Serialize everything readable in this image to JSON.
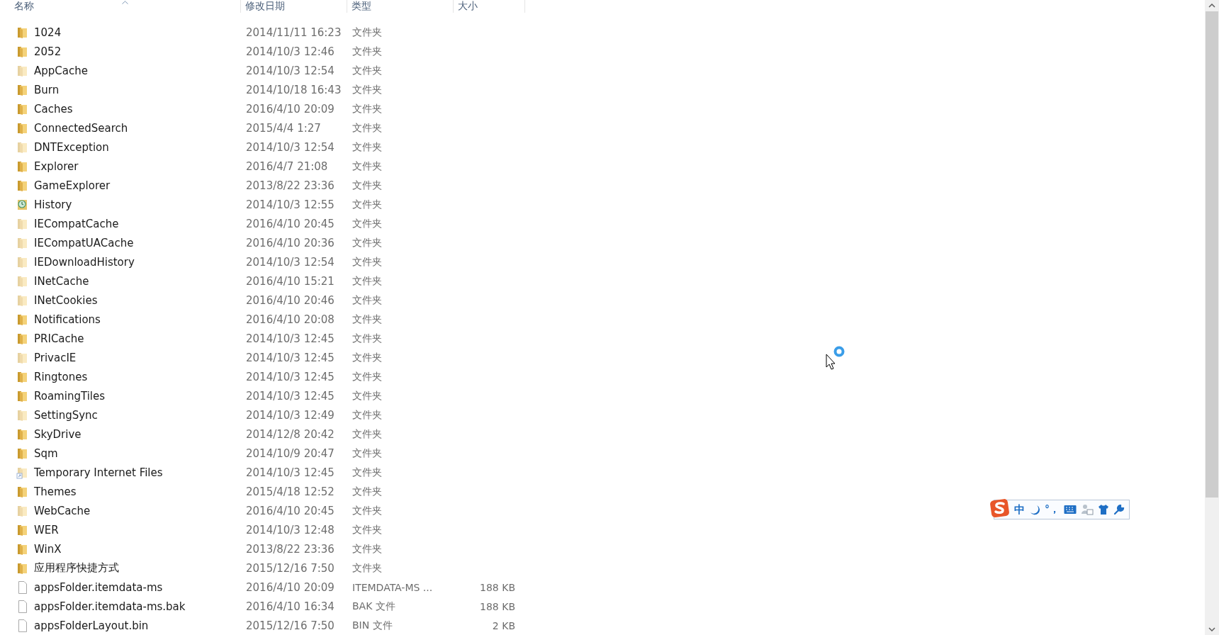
{
  "columns": [
    {
      "label": "名称",
      "sorted": true
    },
    {
      "label": "修改日期"
    },
    {
      "label": "类型"
    },
    {
      "label": "大小"
    }
  ],
  "rows": [
    {
      "name": "1024",
      "date": "2014/11/11 16:23",
      "type": "文件夹",
      "kind": "folder"
    },
    {
      "name": "2052",
      "date": "2014/10/3 12:46",
      "type": "文件夹",
      "kind": "folder"
    },
    {
      "name": "AppCache",
      "date": "2014/10/3 12:54",
      "type": "文件夹",
      "kind": "faded_folder"
    },
    {
      "name": "Burn",
      "date": "2014/10/18 16:43",
      "type": "文件夹",
      "kind": "folder"
    },
    {
      "name": "Caches",
      "date": "2016/4/10 20:09",
      "type": "文件夹",
      "kind": "folder"
    },
    {
      "name": "ConnectedSearch",
      "date": "2015/4/4 1:27",
      "type": "文件夹",
      "kind": "folder"
    },
    {
      "name": "DNTException",
      "date": "2014/10/3 12:54",
      "type": "文件夹",
      "kind": "faded_folder"
    },
    {
      "name": "Explorer",
      "date": "2016/4/7 21:08",
      "type": "文件夹",
      "kind": "folder"
    },
    {
      "name": "GameExplorer",
      "date": "2013/8/22 23:36",
      "type": "文件夹",
      "kind": "folder"
    },
    {
      "name": "History",
      "date": "2014/10/3 12:55",
      "type": "文件夹",
      "kind": "history_folder"
    },
    {
      "name": "IECompatCache",
      "date": "2016/4/10 20:45",
      "type": "文件夹",
      "kind": "faded_folder"
    },
    {
      "name": "IECompatUACache",
      "date": "2016/4/10 20:36",
      "type": "文件夹",
      "kind": "faded_folder"
    },
    {
      "name": "IEDownloadHistory",
      "date": "2014/10/3 12:54",
      "type": "文件夹",
      "kind": "faded_folder"
    },
    {
      "name": "INetCache",
      "date": "2016/4/10 15:21",
      "type": "文件夹",
      "kind": "faded_folder"
    },
    {
      "name": "INetCookies",
      "date": "2016/4/10 20:46",
      "type": "文件夹",
      "kind": "faded_folder"
    },
    {
      "name": "Notifications",
      "date": "2016/4/10 20:08",
      "type": "文件夹",
      "kind": "folder"
    },
    {
      "name": "PRICache",
      "date": "2014/10/3 12:45",
      "type": "文件夹",
      "kind": "folder"
    },
    {
      "name": "PrivacIE",
      "date": "2014/10/3 12:45",
      "type": "文件夹",
      "kind": "faded_folder"
    },
    {
      "name": "Ringtones",
      "date": "2014/10/3 12:45",
      "type": "文件夹",
      "kind": "folder"
    },
    {
      "name": "RoamingTiles",
      "date": "2014/10/3 12:45",
      "type": "文件夹",
      "kind": "folder"
    },
    {
      "name": "SettingSync",
      "date": "2014/10/3 12:49",
      "type": "文件夹",
      "kind": "faded_folder"
    },
    {
      "name": "SkyDrive",
      "date": "2014/12/8 20:42",
      "type": "文件夹",
      "kind": "folder"
    },
    {
      "name": "Sqm",
      "date": "2014/10/9 20:47",
      "type": "文件夹",
      "kind": "folder"
    },
    {
      "name": "Temporary Internet Files",
      "date": "2014/10/3 12:45",
      "type": "文件夹",
      "kind": "shortcut_folder"
    },
    {
      "name": "Themes",
      "date": "2015/4/18 12:52",
      "type": "文件夹",
      "kind": "folder"
    },
    {
      "name": "WebCache",
      "date": "2016/4/10 20:45",
      "type": "文件夹",
      "kind": "faded_folder"
    },
    {
      "name": "WER",
      "date": "2014/10/3 12:48",
      "type": "文件夹",
      "kind": "folder"
    },
    {
      "name": "WinX",
      "date": "2013/8/22 23:36",
      "type": "文件夹",
      "kind": "folder"
    },
    {
      "name": "应用程序快捷方式",
      "date": "2015/12/16 7:50",
      "type": "文件夹",
      "kind": "folder"
    },
    {
      "name": "appsFolder.itemdata-ms",
      "date": "2016/4/10 20:09",
      "type": "ITEMDATA-MS ...",
      "size": "188 KB",
      "kind": "file"
    },
    {
      "name": "appsFolder.itemdata-ms.bak",
      "date": "2016/4/10 16:34",
      "type": "BAK 文件",
      "size": "188 KB",
      "kind": "file"
    },
    {
      "name": "appsFolderLayout.bin",
      "date": "2015/12/16 7:50",
      "type": "BIN 文件",
      "size": "2 KB",
      "kind": "file"
    }
  ],
  "ime_toolbar": {
    "mode": "中",
    "punctuation": "°，"
  }
}
